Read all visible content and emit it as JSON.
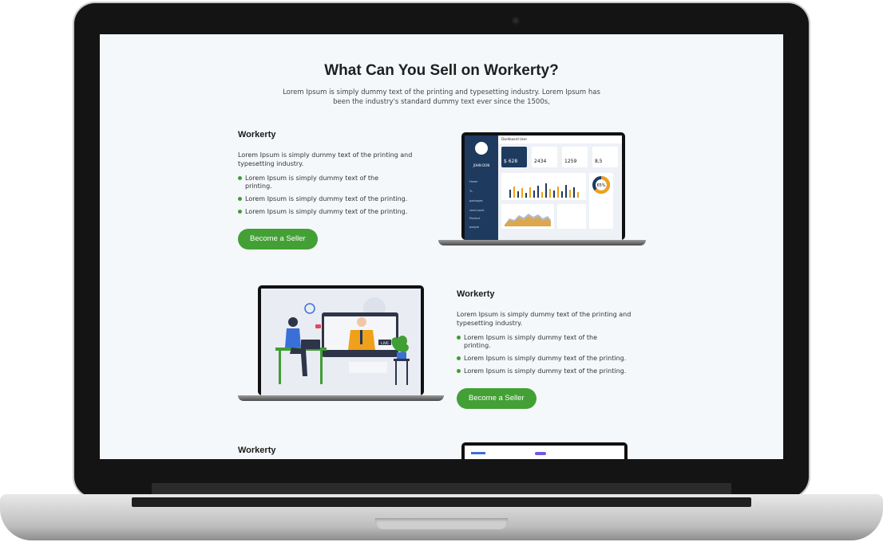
{
  "heading": "What Can You Sell  on Workerty?",
  "subheading": "Lorem Ipsum is simply dummy text of the printing and typesetting industry. Lorem Ipsum has been the industry's standard dummy text ever since the 1500s,",
  "sections": [
    {
      "title": "Workerty",
      "description": "Lorem Ipsum is simply dummy text of the printing and typesetting industry.",
      "bullets": [
        "Lorem Ipsum is simply dummy text of the printing.",
        "Lorem Ipsum is simply dummy text of the printing.",
        "Lorem Ipsum is simply dummy text of the printing."
      ],
      "button": "Become a Seller"
    },
    {
      "title": "Workerty",
      "description": "Lorem Ipsum is simply dummy text of the printing and typesetting industry.",
      "bullets": [
        "Lorem Ipsum is simply dummy text of the printing.",
        "Lorem Ipsum is simply dummy text of the printing.",
        "Lorem Ipsum is simply dummy text of the printing."
      ],
      "button": "Become a Seller"
    },
    {
      "title": "Workerty"
    }
  ],
  "dashboard": {
    "header": "Dashboard User",
    "user": "JOHN DON",
    "nav": [
      "Home",
      "Tr..",
      "packages",
      "send point",
      "Product",
      "people"
    ],
    "cards": [
      "$ 628",
      "2434",
      "1259",
      "8,5"
    ],
    "donut_label": "65%"
  },
  "video": {
    "live_label": "LIVE"
  },
  "colors": {
    "accent": "#43a035",
    "dashboard_side": "#1e3a5f",
    "bars_dark": "#1e3a5f",
    "bars_orange": "#f0a019"
  }
}
